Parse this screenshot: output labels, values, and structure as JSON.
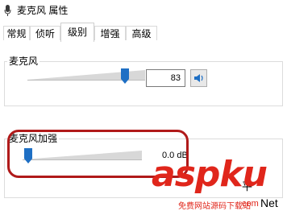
{
  "window": {
    "title": "麦克风 属性"
  },
  "tabs": [
    {
      "label": "常规",
      "active": false
    },
    {
      "label": "侦听",
      "active": false
    },
    {
      "label": "级别",
      "active": true
    },
    {
      "label": "增强",
      "active": false
    },
    {
      "label": "高级",
      "active": false
    }
  ],
  "microphone": {
    "label": "麦克风",
    "level_value": "83",
    "level_fraction": 0.83,
    "speaker_icon": "speaker-icon"
  },
  "boost": {
    "label": "麦克风加强",
    "value_text": "0.0 dB",
    "level_fraction": 0.0
  },
  "partial_text": {
    "right_glyph": "平",
    "bottom_right": "Net"
  },
  "watermark": {
    "main": "aspku",
    "sub": "免费网站源码下载站",
    "corner": "com"
  },
  "colors": {
    "highlight": "#b01a1a",
    "thumb": "#1e6fc4",
    "watermark": "#e0261b"
  }
}
